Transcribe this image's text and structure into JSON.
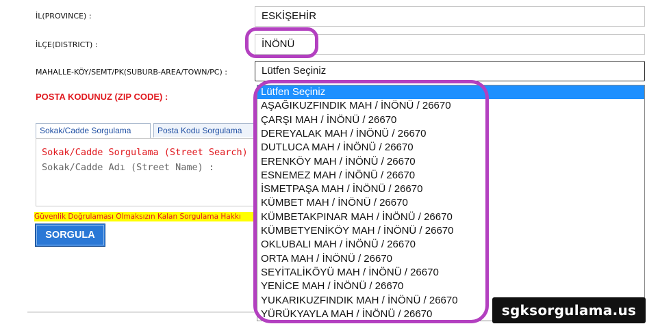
{
  "form": {
    "province_label": "İL(PROVINCE) :",
    "province_value": "ESKİŞEHİR",
    "district_label": "İLÇE(DISTRICT) :",
    "district_value": "İNÖNÜ",
    "suburb_label": "MAHALLE-KÖY/SEMT/PK(SUBURB-AREA/TOWN/PC) :",
    "suburb_value": "Lütfen Seçiniz",
    "zip_label": "POSTA KODUNUZ (ZIP CODE) :"
  },
  "tabs": [
    {
      "label": "Sokak/Cadde Sorgulama",
      "active": true
    },
    {
      "label": "Posta Kodu Sorgulama",
      "active": false
    }
  ],
  "panel": {
    "title": "Sokak/Cadde Sorgulama (Street Search)",
    "street_label": "Sokak/Cadde Adı (Street Name) :"
  },
  "warning": "Güvenlik Doğrulaması Olmaksızın Kalan Sorgulama Hakkı",
  "query_button": "SORGULA",
  "dropdown": {
    "selected_index": 0,
    "options": [
      "Lütfen Seçiniz",
      "AŞAĞIKUZFINDIK MAH / İNÖNÜ / 26670",
      "ÇARŞI MAH / İNÖNÜ / 26670",
      "DEREYALAK MAH / İNÖNÜ / 26670",
      "DUTLUCA MAH / İNÖNÜ / 26670",
      "ERENKÖY MAH / İNÖNÜ / 26670",
      "ESNEMEZ MAH / İNÖNÜ / 26670",
      "İSMETPAŞA MAH / İNÖNÜ / 26670",
      "KÜMBET MAH / İNÖNÜ / 26670",
      "KÜMBETAKPINAR MAH / İNÖNÜ / 26670",
      "KÜMBETYENİKÖY MAH / İNÖNÜ / 26670",
      "OKLUBALI MAH / İNÖNÜ / 26670",
      "ORTA MAH / İNÖNÜ / 26670",
      "SEYİTALİKÖYÜ MAH / İNÖNÜ / 26670",
      "YENİCE MAH / İNÖNÜ / 26670",
      "YUKARIKUZFINDIK MAH / İNÖNÜ / 26670",
      "YÜRÜKYAYLA MAH / İNÖNÜ / 26670"
    ]
  },
  "watermark": "sgksorgulama.us",
  "colors": {
    "highlight_ring": "#b340c0",
    "selected_option": "#1e90ff",
    "button": "#2a78d6",
    "warning_bg": "#ffff00",
    "error_text": "#e0191f"
  }
}
